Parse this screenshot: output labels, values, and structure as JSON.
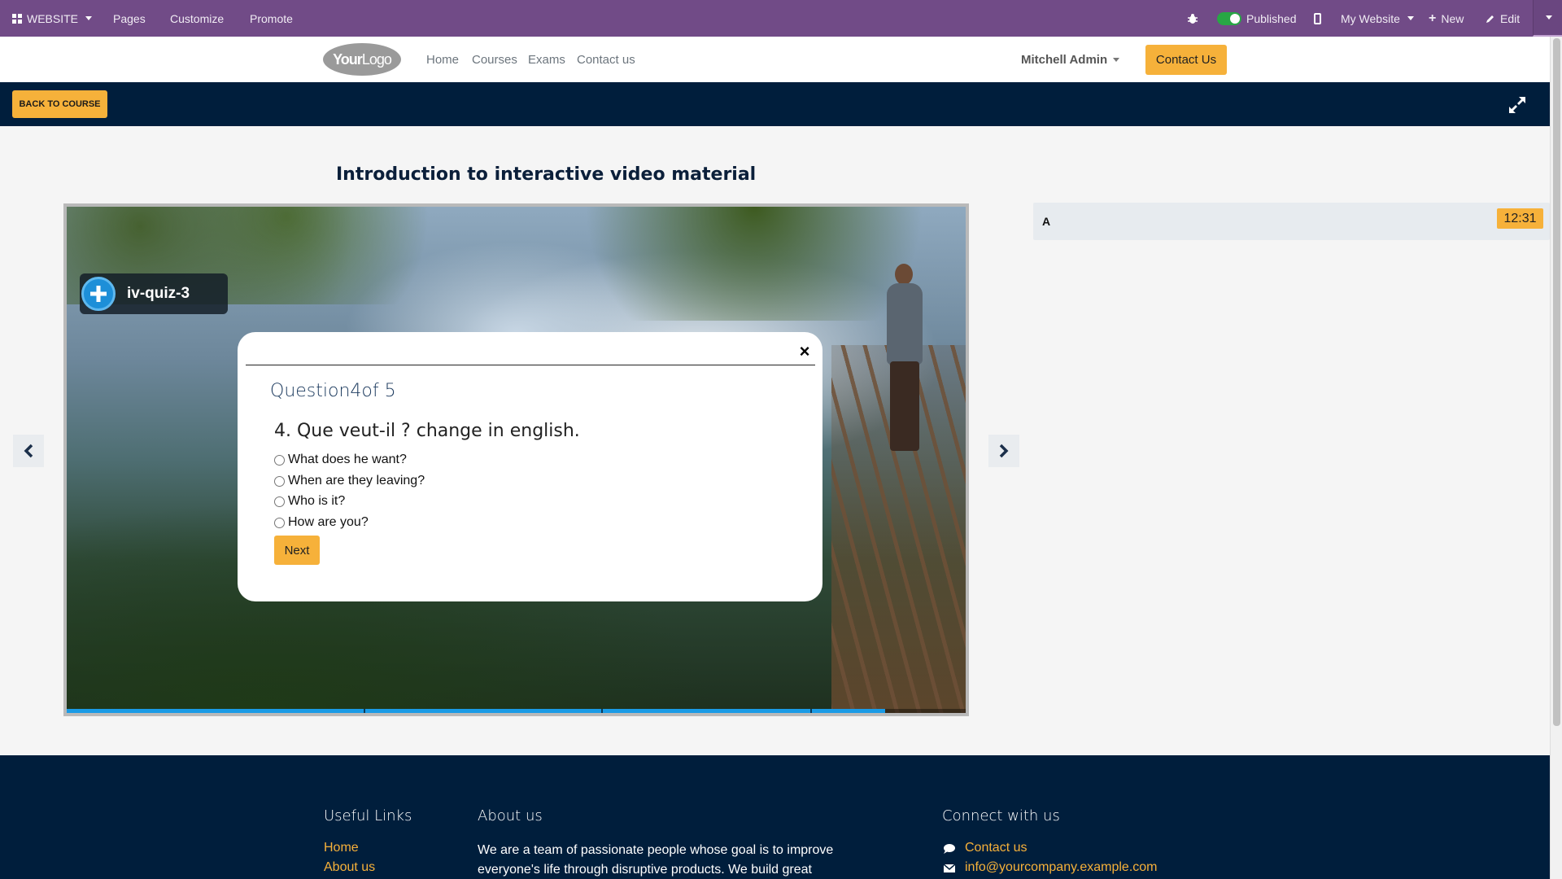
{
  "admin_bar": {
    "website_label": "WEBSITE",
    "pages_label": "Pages",
    "customize_label": "Customize",
    "promote_label": "Promote",
    "published_label": "Published",
    "site_selector_label": "My Website",
    "new_label": "New",
    "edit_label": "Edit"
  },
  "header": {
    "logo_text_bold": "Your",
    "logo_text_light": "Logo",
    "nav": [
      "Home",
      "Courses",
      "Exams",
      "Contact us"
    ],
    "user_name": "Mitchell Admin",
    "contact_button": "Contact Us"
  },
  "course_bar": {
    "back_button": "BACK TO COURSE"
  },
  "lesson": {
    "title": "Introduction to interactive video material",
    "quiz_tag": "iv-quiz-3",
    "progress_fraction": 0.91,
    "marker_fractions": [
      0.33,
      0.595,
      0.827
    ]
  },
  "quiz": {
    "counter": "Question4of 5",
    "question": "4. Que veut-il ? change in english.",
    "options": [
      "What does he want?",
      "When are they leaving?",
      "Who is it?",
      "How are you?"
    ],
    "next_button": "Next",
    "close_symbol": "×"
  },
  "playlist": {
    "item_label": "A",
    "item_time": "12:31"
  },
  "footer": {
    "useful_links_heading": "Useful Links",
    "useful_links": [
      "Home",
      "About us"
    ],
    "about_heading": "About us",
    "about_text": "We are a team of passionate people whose goal is to improve everyone's life through disruptive products. We build great",
    "connect_heading": "Connect with us",
    "connect_links": [
      "Contact us",
      "info@yourcompany.example.com"
    ]
  },
  "colors": {
    "admin_bar": "#714b87",
    "accent": "#f6b13a",
    "navy": "#001e3c",
    "progress": "#1a9be6"
  },
  "icons": [
    "apps-grid-icon",
    "bug-icon",
    "mobile-icon",
    "plus-icon",
    "pencil-icon",
    "expand-icon",
    "chevron-left-icon",
    "chevron-right-icon",
    "chat-icon",
    "envelope-icon",
    "close-icon"
  ]
}
